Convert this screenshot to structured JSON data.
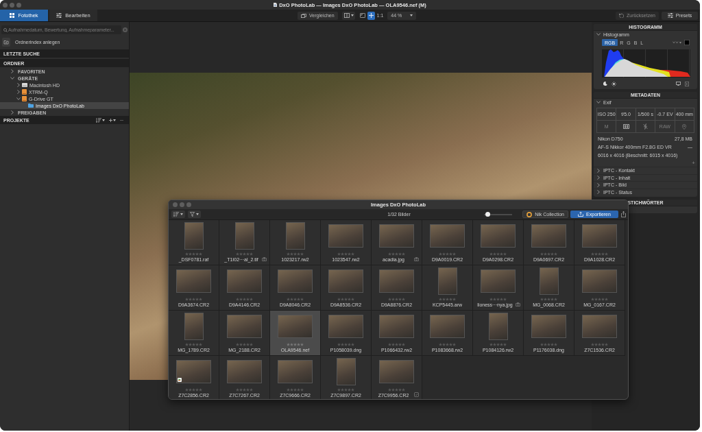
{
  "window": {
    "title": "DxO PhotoLab — Images DxO PhotoLab — OLA9546.nef (M)"
  },
  "tabs": [
    {
      "label": "Fotothek",
      "selected": true
    },
    {
      "label": "Bearbeiten",
      "selected": false
    }
  ],
  "toolbar": {
    "compare": "Vergleichen",
    "view_tools": [
      {
        "kind": "fit",
        "selected": false
      },
      {
        "kind": "move",
        "selected": true
      },
      {
        "kind": "actual-size",
        "label": "1:1",
        "selected": false
      }
    ],
    "zoom": "44 %",
    "reset": {
      "label": "Zurücksetzen",
      "disabled": true
    },
    "presets": "Presets"
  },
  "sidebar": {
    "search": {
      "placeholder": "Aufnahmedatum, Bewertung, Aufnahmeparameter..."
    },
    "index_button": "Ordnerindex anlegen",
    "recent": {
      "title": "LETZTE SUCHE"
    },
    "folders": {
      "title": "ORDNER",
      "tree": [
        {
          "label": "FAVORITEN",
          "kind": "group",
          "expanded": false,
          "selected": false
        },
        {
          "label": "GERÄTE",
          "kind": "group",
          "expanded": true,
          "selected": false,
          "children": [
            {
              "label": "Macintosh HD",
              "kind": "internal-drive",
              "expanded": false,
              "selected": false
            },
            {
              "label": "XTRM-Q",
              "kind": "external-drive",
              "expanded": false,
              "selected": false
            },
            {
              "label": "G-Drive GT",
              "kind": "external-drive",
              "expanded": true,
              "selected": false,
              "children": [
                {
                  "label": "Images DxO PhotoLab",
                  "kind": "folder",
                  "selected": true
                }
              ]
            }
          ]
        },
        {
          "label": "FREIGABEN",
          "kind": "group",
          "expanded": false,
          "selected": false
        }
      ]
    },
    "projects": {
      "title": "PROJEKTE",
      "remove_disabled": true
    }
  },
  "inspector": {
    "histogram": {
      "title": "HISTOGRAMM",
      "section": {
        "label": "Histogramm",
        "expanded": true
      },
      "channels": [
        {
          "label": "RGB",
          "selected": true
        },
        {
          "label": "R",
          "selected": false
        },
        {
          "label": "G",
          "selected": false
        },
        {
          "label": "B",
          "selected": false
        },
        {
          "label": "L",
          "selected": false
        }
      ]
    },
    "metadata": {
      "title": "METADATEN",
      "exif": {
        "label": "Exif",
        "expanded": true,
        "cells": [
          {
            "kind": "text",
            "text": "ISO 250",
            "dim": false
          },
          {
            "kind": "text",
            "text": "f/5.0",
            "dim": false
          },
          {
            "kind": "text",
            "text": "1/500 s",
            "dim": false
          },
          {
            "kind": "text",
            "text": "-0.7 EV",
            "dim": false
          },
          {
            "kind": "text",
            "text": "400 mm",
            "dim": false
          },
          {
            "kind": "text",
            "text": "M",
            "dim": true
          },
          {
            "kind": "metering"
          },
          {
            "kind": "flash"
          },
          {
            "kind": "text",
            "text": "RAW",
            "dim": true
          },
          {
            "kind": "location"
          }
        ],
        "lines": [
          {
            "label": "Nikon D750",
            "value": "27,8 MB"
          },
          {
            "label": "AF-S Nikkor 400mm F2.8G ED VR",
            "value": "—"
          },
          {
            "label": "6016 x 4016 (Beschnitt: 6015 x 4016)"
          }
        ],
        "add": "+"
      },
      "iptc": [
        {
          "label": "IPTC - Kontakt",
          "expanded": false
        },
        {
          "label": "IPTC - Inhalt",
          "expanded": false
        },
        {
          "label": "IPTC - Bild",
          "expanded": false
        },
        {
          "label": "IPTC - Status",
          "expanded": false
        }
      ]
    },
    "keywords": {
      "title": "STICHWÖRTER"
    }
  },
  "filmstrip": {
    "title": "Images DxO PhotoLab",
    "count": "1/32 Bilder",
    "thumbnail_size": {
      "level": 0.05
    },
    "nik": "Nik Collection",
    "export": "Exportieren",
    "items": [
      {
        "name": "_DSF0781.raf",
        "kind": "portrait",
        "stars": 0,
        "selected": false,
        "edited": false,
        "non_raw": false,
        "exported": false
      },
      {
        "name": "_T1I02···al_2.tif",
        "kind": "portrait",
        "stars": 0,
        "selected": false,
        "edited": false,
        "non_raw": true,
        "exported": false
      },
      {
        "name": "1023217.rw2",
        "kind": "portrait",
        "stars": 0,
        "selected": false,
        "edited": false,
        "non_raw": false,
        "exported": false
      },
      {
        "name": "1023547.rw2",
        "kind": "landscape",
        "stars": 0,
        "selected": false,
        "edited": false,
        "non_raw": false,
        "exported": false
      },
      {
        "name": "acadia.jpg",
        "kind": "landscape",
        "stars": 0,
        "selected": false,
        "edited": false,
        "non_raw": true,
        "exported": false
      },
      {
        "name": "D9A0019.CR2",
        "kind": "landscape",
        "stars": 0,
        "selected": false,
        "edited": false,
        "non_raw": false,
        "exported": false
      },
      {
        "name": "D9A0298.CR2",
        "kind": "landscape",
        "stars": 0,
        "selected": false,
        "edited": false,
        "non_raw": false,
        "exported": false
      },
      {
        "name": "D9A0697.CR2",
        "kind": "landscape",
        "stars": 0,
        "selected": false,
        "edited": false,
        "non_raw": false,
        "exported": false
      },
      {
        "name": "D9A1028.CR2",
        "kind": "landscape",
        "stars": 0,
        "selected": false,
        "edited": false,
        "non_raw": false,
        "exported": false
      },
      {
        "name": "D9A3674.CR2",
        "kind": "landscape",
        "stars": 0,
        "selected": false,
        "edited": false,
        "non_raw": false,
        "exported": false
      },
      {
        "name": "D9A4146.CR2",
        "kind": "landscape",
        "stars": 0,
        "selected": false,
        "edited": false,
        "non_raw": false,
        "exported": false
      },
      {
        "name": "D9A8046.CR2",
        "kind": "landscape",
        "stars": 0,
        "selected": false,
        "edited": false,
        "non_raw": false,
        "exported": false
      },
      {
        "name": "D9A8536.CR2",
        "kind": "landscape",
        "stars": 0,
        "selected": false,
        "edited": false,
        "non_raw": false,
        "exported": false
      },
      {
        "name": "D9A8876.CR2",
        "kind": "landscape",
        "stars": 0,
        "selected": false,
        "edited": false,
        "non_raw": false,
        "exported": false
      },
      {
        "name": "KCP5445.arw",
        "kind": "portrait",
        "stars": 0,
        "selected": false,
        "edited": false,
        "non_raw": false,
        "exported": false
      },
      {
        "name": "lioness···nya.jpg",
        "kind": "landscape",
        "stars": 0,
        "selected": false,
        "edited": false,
        "non_raw": true,
        "exported": false
      },
      {
        "name": "MG_0068.CR2",
        "kind": "portrait",
        "stars": 0,
        "selected": false,
        "edited": false,
        "non_raw": false,
        "exported": false
      },
      {
        "name": "MG_0167.CR2",
        "kind": "landscape",
        "stars": 0,
        "selected": false,
        "edited": false,
        "non_raw": false,
        "exported": false
      },
      {
        "name": "MG_1789.CR2",
        "kind": "portrait",
        "stars": 0,
        "selected": false,
        "edited": false,
        "non_raw": false,
        "exported": false
      },
      {
        "name": "MG_2188.CR2",
        "kind": "landscape",
        "stars": 0,
        "selected": false,
        "edited": false,
        "non_raw": false,
        "exported": false
      },
      {
        "name": "OLA9546.nef",
        "kind": "landscape",
        "stars": 0,
        "selected": true,
        "edited": false,
        "non_raw": false,
        "exported": false
      },
      {
        "name": "P1058039.dng",
        "kind": "landscape",
        "stars": 0,
        "selected": false,
        "edited": false,
        "non_raw": false,
        "exported": false
      },
      {
        "name": "P1066432.rw2",
        "kind": "landscape",
        "stars": 0,
        "selected": false,
        "edited": false,
        "non_raw": false,
        "exported": false
      },
      {
        "name": "P1083668.rw2",
        "kind": "landscape",
        "stars": 0,
        "selected": false,
        "edited": false,
        "non_raw": false,
        "exported": false
      },
      {
        "name": "P1084126.rw2",
        "kind": "portrait",
        "stars": 0,
        "selected": false,
        "edited": false,
        "non_raw": false,
        "exported": false
      },
      {
        "name": "P1176038.dng",
        "kind": "landscape",
        "stars": 0,
        "selected": false,
        "edited": false,
        "non_raw": false,
        "exported": false
      },
      {
        "name": "Z7C1536.CR2",
        "kind": "landscape",
        "stars": 0,
        "selected": false,
        "edited": false,
        "non_raw": false,
        "exported": false
      },
      {
        "name": "Z7C2856.CR2",
        "kind": "landscape",
        "stars": 0,
        "selected": false,
        "edited": true,
        "non_raw": false,
        "exported": false
      },
      {
        "name": "Z7C7267.CR2",
        "kind": "landscape",
        "stars": 0,
        "selected": false,
        "edited": false,
        "non_raw": false,
        "exported": false
      },
      {
        "name": "Z7C9666.CR2",
        "kind": "landscape",
        "stars": 0,
        "selected": false,
        "edited": false,
        "non_raw": false,
        "exported": false
      },
      {
        "name": "Z7C9897.CR2",
        "kind": "portrait",
        "stars": 0,
        "selected": false,
        "edited": false,
        "non_raw": false,
        "exported": false
      },
      {
        "name": "Z7C9956.CR2",
        "kind": "landscape",
        "stars": 0,
        "selected": false,
        "edited": false,
        "non_raw": false,
        "exported": true
      }
    ]
  }
}
